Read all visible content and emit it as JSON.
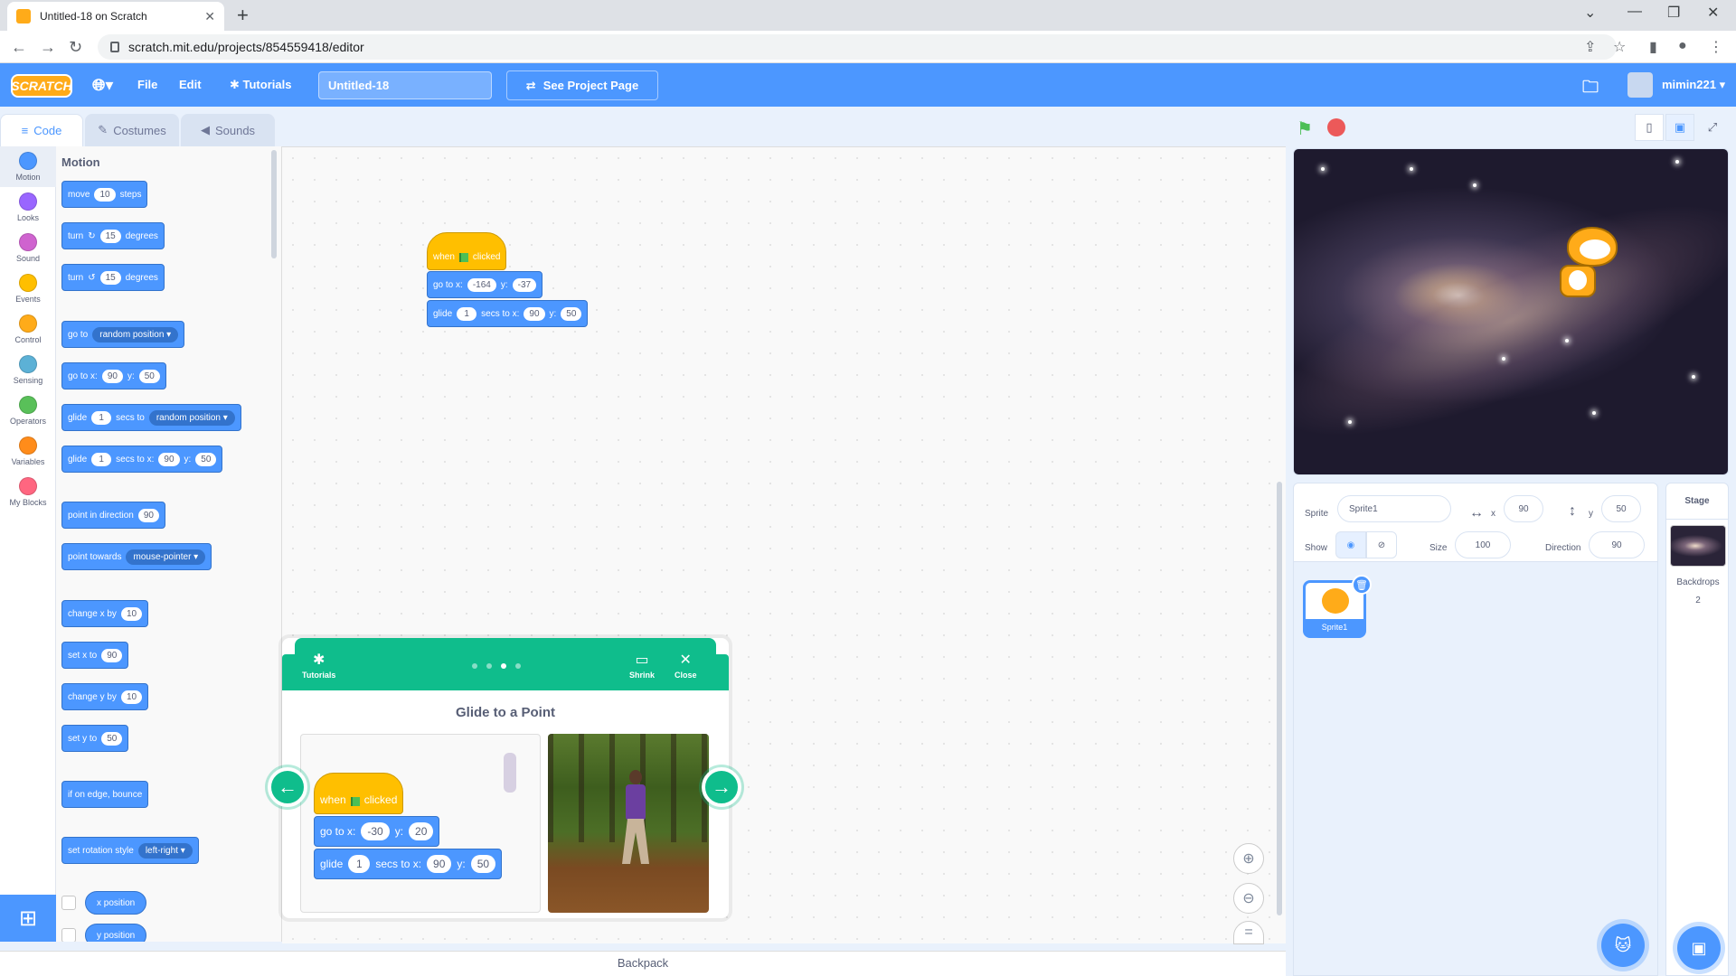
{
  "browser": {
    "tab_title": "Untitled-18 on Scratch",
    "url": "scratch.mit.edu/projects/854559418/editor",
    "new_tab": "+"
  },
  "menu": {
    "logo": "SCRATCH",
    "file": "File",
    "edit": "Edit",
    "tutorials": "Tutorials",
    "project_title": "Untitled-18",
    "see_project": "See Project Page",
    "username": "mimin221"
  },
  "tabs": {
    "code": "Code",
    "costumes": "Costumes",
    "sounds": "Sounds"
  },
  "categories": [
    {
      "label": "Motion",
      "color": "#4c97ff"
    },
    {
      "label": "Looks",
      "color": "#9966ff"
    },
    {
      "label": "Sound",
      "color": "#cf63cf"
    },
    {
      "label": "Events",
      "color": "#ffbf00"
    },
    {
      "label": "Control",
      "color": "#ffab19"
    },
    {
      "label": "Sensing",
      "color": "#5cb1d6"
    },
    {
      "label": "Operators",
      "color": "#59c059"
    },
    {
      "label": "Variables",
      "color": "#ff8c1a"
    },
    {
      "label": "My Blocks",
      "color": "#ff6680"
    }
  ],
  "palette": {
    "title": "Motion",
    "move": {
      "a": "move",
      "n": "10",
      "b": "steps"
    },
    "turn_right": {
      "a": "turn",
      "n": "15",
      "b": "degrees"
    },
    "turn_left": {
      "a": "turn",
      "n": "15",
      "b": "degrees"
    },
    "goto": {
      "a": "go to",
      "dd": "random position"
    },
    "gotoxy": {
      "a": "go to x:",
      "x": "90",
      "b": "y:",
      "y": "50"
    },
    "glide_to": {
      "a": "glide",
      "n": "1",
      "b": "secs to",
      "dd": "random position"
    },
    "glide_xy": {
      "a": "glide",
      "n": "1",
      "b": "secs to x:",
      "x": "90",
      "c": "y:",
      "y": "50"
    },
    "point_dir": {
      "a": "point in direction",
      "n": "90"
    },
    "point_towards": {
      "a": "point towards",
      "dd": "mouse-pointer"
    },
    "change_x": {
      "a": "change x by",
      "n": "10"
    },
    "set_x": {
      "a": "set x to",
      "n": "90"
    },
    "change_y": {
      "a": "change y by",
      "n": "10"
    },
    "set_y": {
      "a": "set y to",
      "n": "50"
    },
    "bounce": "if on edge, bounce",
    "rotation": {
      "a": "set rotation style",
      "dd": "left-right"
    },
    "x_position": "x position",
    "y_position": "y position"
  },
  "script": {
    "hat": {
      "a": "when",
      "b": "clicked"
    },
    "gotoxy": {
      "a": "go to x:",
      "x": "-164",
      "b": "y:",
      "y": "-37"
    },
    "glide": {
      "a": "glide",
      "n": "1",
      "b": "secs to x:",
      "x": "90",
      "c": "y:",
      "y": "50"
    }
  },
  "tutorial": {
    "label": "Tutorials",
    "shrink": "Shrink",
    "close": "Close",
    "title": "Glide to a Point",
    "step_current": 3,
    "step_total": 4,
    "hat": {
      "a": "when",
      "b": "clicked"
    },
    "gotoxy": {
      "a": "go to x:",
      "x": "-30",
      "b": "y:",
      "y": "20"
    },
    "glide": {
      "a": "glide",
      "n": "1",
      "b": "secs to x:",
      "x": "90",
      "c": "y:",
      "y": "50"
    }
  },
  "sprite_info": {
    "sprite_label": "Sprite",
    "sprite_name": "Sprite1",
    "x_label": "x",
    "x_value": "90",
    "y_label": "y",
    "y_value": "50",
    "show_label": "Show",
    "size_label": "Size",
    "size_value": "100",
    "direction_label": "Direction",
    "direction_value": "90"
  },
  "sprites": [
    {
      "name": "Sprite1"
    }
  ],
  "stage_panel": {
    "title": "Stage",
    "backdrops_label": "Backdrops",
    "backdrops_count": "2"
  },
  "backpack": "Backpack"
}
